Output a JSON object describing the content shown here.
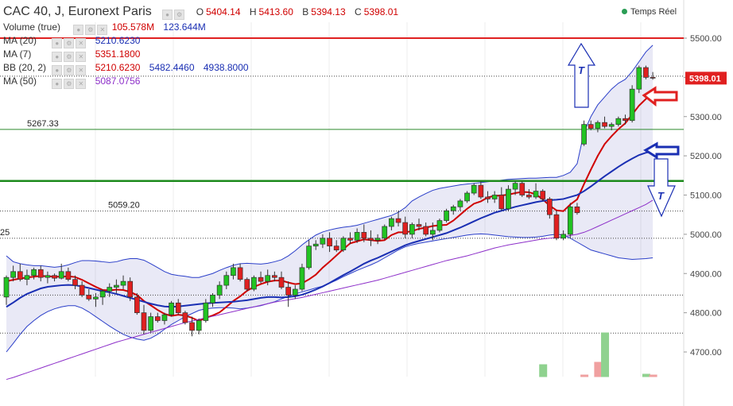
{
  "header": {
    "title": "CAC 40, J, Euronext Paris",
    "ohlc": [
      {
        "label": "O",
        "value": "5404.14"
      },
      {
        "label": "H",
        "value": "5413.60"
      },
      {
        "label": "B",
        "value": "5394.13"
      },
      {
        "label": "C",
        "value": "5398.01"
      }
    ],
    "realtime_label": "Temps Réel"
  },
  "indicators": [
    {
      "name": "Volume (true)",
      "values": [
        "105.578M",
        "123.644M"
      ],
      "colors": [
        "#d00000",
        "#1a2fb3"
      ]
    },
    {
      "name": "MA (20)",
      "values": [
        "5210.6230"
      ],
      "colors": [
        "#1a2fb3"
      ]
    },
    {
      "name": "MA (7)",
      "values": [
        "5351.1800"
      ],
      "colors": [
        "#d00000"
      ]
    },
    {
      "name": "BB (20, 2)",
      "values": [
        "5210.6230",
        "5482.4460",
        "4938.8000"
      ],
      "colors": [
        "#d00000",
        "#1a2fb3",
        "#1a2fb3"
      ]
    },
    {
      "name": "MA (50)",
      "values": [
        "5087.0756"
      ],
      "colors": [
        "#8d2fc9"
      ]
    }
  ],
  "price_label": "5398.01",
  "chart_data": {
    "type": "candlestick",
    "ylim": [
      4640,
      5550
    ],
    "y_ticks": [
      4700,
      4800,
      4900,
      5000,
      5100,
      5200,
      5300,
      5400,
      5500
    ],
    "y_tick_labels": [
      "4700.00",
      "4800.00",
      "4900.00",
      "5000.00",
      "5100.00",
      "5200.00",
      "5300.00",
      "5400.00",
      "5500.00"
    ],
    "candles": [
      [
        4840,
        4895,
        4820,
        4890
      ],
      [
        4890,
        4920,
        4880,
        4905
      ],
      [
        4905,
        4925,
        4880,
        4885
      ],
      [
        4885,
        4910,
        4870,
        4895
      ],
      [
        4895,
        4915,
        4885,
        4910
      ],
      [
        4910,
        4920,
        4880,
        4890
      ],
      [
        4890,
        4905,
        4875,
        4895
      ],
      [
        4895,
        4900,
        4880,
        4888
      ],
      [
        4888,
        4925,
        4885,
        4905
      ],
      [
        4905,
        4915,
        4880,
        4885
      ],
      [
        4885,
        4895,
        4860,
        4870
      ],
      [
        4870,
        4880,
        4840,
        4845
      ],
      [
        4845,
        4860,
        4830,
        4835
      ],
      [
        4835,
        4850,
        4815,
        4840
      ],
      [
        4840,
        4860,
        4820,
        4855
      ],
      [
        4855,
        4875,
        4840,
        4865
      ],
      [
        4865,
        4885,
        4850,
        4870
      ],
      [
        4870,
        4895,
        4860,
        4880
      ],
      [
        4880,
        4890,
        4830,
        4840
      ],
      [
        4840,
        4850,
        4795,
        4800
      ],
      [
        4800,
        4820,
        4745,
        4755
      ],
      [
        4755,
        4800,
        4750,
        4790
      ],
      [
        4790,
        4800,
        4775,
        4780
      ],
      [
        4780,
        4800,
        4770,
        4795
      ],
      [
        4795,
        4830,
        4790,
        4825
      ],
      [
        4825,
        4835,
        4795,
        4800
      ],
      [
        4800,
        4805,
        4770,
        4775
      ],
      [
        4775,
        4790,
        4740,
        4755
      ],
      [
        4755,
        4785,
        4745,
        4780
      ],
      [
        4780,
        4835,
        4775,
        4825
      ],
      [
        4825,
        4850,
        4815,
        4845
      ],
      [
        4845,
        4880,
        4835,
        4870
      ],
      [
        4870,
        4905,
        4860,
        4895
      ],
      [
        4895,
        4925,
        4885,
        4915
      ],
      [
        4915,
        4925,
        4880,
        4885
      ],
      [
        4885,
        4890,
        4855,
        4860
      ],
      [
        4860,
        4895,
        4855,
        4890
      ],
      [
        4890,
        4905,
        4875,
        4880
      ],
      [
        4880,
        4910,
        4870,
        4895
      ],
      [
        4895,
        4905,
        4880,
        4890
      ],
      [
        4890,
        4905,
        4860,
        4865
      ],
      [
        4865,
        4880,
        4815,
        4845
      ],
      [
        4845,
        4870,
        4835,
        4860
      ],
      [
        4860,
        4925,
        4855,
        4915
      ],
      [
        4915,
        4985,
        4910,
        4970
      ],
      [
        4970,
        4985,
        4960,
        4975
      ],
      [
        4975,
        5000,
        4965,
        4990
      ],
      [
        4990,
        5005,
        4955,
        4970
      ],
      [
        4970,
        4985,
        4955,
        4960
      ],
      [
        4960,
        4995,
        4955,
        4990
      ],
      [
        4990,
        5005,
        4975,
        4985
      ],
      [
        4985,
        5015,
        4978,
        5005
      ],
      [
        5005,
        5025,
        4980,
        4990
      ],
      [
        4990,
        5010,
        4970,
        4985
      ],
      [
        4985,
        5000,
        4975,
        4990
      ],
      [
        4990,
        5025,
        4985,
        5020
      ],
      [
        5020,
        5045,
        5010,
        5040
      ],
      [
        5040,
        5060,
        5020,
        5030
      ],
      [
        5030,
        5045,
        4990,
        5000
      ],
      [
        5000,
        5030,
        4990,
        5025
      ],
      [
        5025,
        5040,
        5010,
        5020
      ],
      [
        5020,
        5030,
        4995,
        5000
      ],
      [
        5000,
        5030,
        4985,
        5010
      ],
      [
        5010,
        5040,
        5005,
        5035
      ],
      [
        5035,
        5065,
        5030,
        5060
      ],
      [
        5060,
        5075,
        5050,
        5070
      ],
      [
        5070,
        5090,
        5060,
        5085
      ],
      [
        5085,
        5110,
        5080,
        5105
      ],
      [
        5105,
        5130,
        5100,
        5125
      ],
      [
        5125,
        5135,
        5090,
        5095
      ],
      [
        5095,
        5110,
        5080,
        5090
      ],
      [
        5090,
        5110,
        5080,
        5100
      ],
      [
        5100,
        5120,
        5060,
        5065
      ],
      [
        5065,
        5125,
        5060,
        5115
      ],
      [
        5115,
        5135,
        5100,
        5130
      ],
      [
        5130,
        5135,
        5095,
        5100
      ],
      [
        5100,
        5115,
        5090,
        5095
      ],
      [
        5095,
        5130,
        5090,
        5110
      ],
      [
        5110,
        5115,
        5085,
        5090
      ],
      [
        5090,
        5095,
        5040,
        5050
      ],
      [
        5050,
        5060,
        4985,
        4990
      ],
      [
        4990,
        5010,
        4985,
        5000
      ],
      [
        5000,
        5080,
        4990,
        5070
      ],
      [
        5070,
        5080,
        5050,
        5055
      ],
      [
        5230,
        5290,
        5225,
        5280
      ],
      [
        5280,
        5290,
        5265,
        5270
      ],
      [
        5270,
        5290,
        5260,
        5285
      ],
      [
        5285,
        5300,
        5270,
        5275
      ],
      [
        5275,
        5285,
        5265,
        5280
      ],
      [
        5280,
        5300,
        5275,
        5295
      ],
      [
        5295,
        5305,
        5280,
        5290
      ],
      [
        5290,
        5380,
        5285,
        5370
      ],
      [
        5370,
        5430,
        5360,
        5425
      ],
      [
        5425,
        5430,
        5395,
        5400
      ],
      [
        5400,
        5413.6,
        5394.1,
        5398.0
      ]
    ],
    "lines": [
      {
        "name": "MA (7)",
        "color": "#d00000",
        "values": [
          4880,
          4884,
          4887,
          4890,
          4892,
          4894,
          4893,
          4892,
          4892,
          4893,
          4891,
          4884,
          4875,
          4866,
          4858,
          4857,
          4859,
          4858,
          4853,
          4845,
          4830,
          4819,
          4807,
          4797,
          4792,
          4795,
          4793,
          4787,
          4779,
          4787,
          4793,
          4801,
          4815,
          4830,
          4842,
          4856,
          4866,
          4873,
          4879,
          4882,
          4882,
          4877,
          4873,
          4875,
          4885,
          4897,
          4915,
          4930,
          4946,
          4962,
          4977,
          4982,
          4987,
          4985,
          4983,
          4985,
          4998,
          5005,
          5005,
          5008,
          5014,
          5017,
          5021,
          5023,
          5024,
          5035,
          5050,
          5065,
          5078,
          5084,
          5094,
          5098,
          5099,
          5101,
          5105,
          5108,
          5107,
          5102,
          5089,
          5073,
          5061,
          5059,
          5076,
          5089,
          5128,
          5165,
          5200,
          5230,
          5250,
          5268,
          5283,
          5305,
          5328,
          5345,
          5360
        ]
      },
      {
        "name": "MA (20)",
        "color": "#1a2fb3",
        "values": [
          4815,
          4826,
          4838,
          4848,
          4855,
          4862,
          4866,
          4868,
          4870,
          4871,
          4870,
          4867,
          4863,
          4859,
          4855,
          4852,
          4848,
          4843,
          4838,
          4833,
          4828,
          4823,
          4819,
          4816,
          4815,
          4816,
          4818,
          4820,
          4822,
          4824,
          4825,
          4826,
          4827,
          4828,
          4830,
          4832,
          4835,
          4838,
          4840,
          4840,
          4839,
          4840,
          4842,
          4846,
          4852,
          4859,
          4867,
          4876,
          4886,
          4896,
          4905,
          4915,
          4925,
          4933,
          4940,
          4948,
          4956,
          4964,
          4972,
          4978,
          4983,
          4988,
          4993,
          4998,
          5003,
          5010,
          5017,
          5025,
          5033,
          5041,
          5048,
          5055,
          5060,
          5065,
          5070,
          5074,
          5078,
          5082,
          5085,
          5087,
          5088,
          5090,
          5095,
          5100,
          5110,
          5122,
          5135,
          5148,
          5160,
          5172,
          5183,
          5193,
          5202,
          5208,
          5211
        ]
      },
      {
        "name": "MA (50)",
        "color": "#8d2fc9",
        "values": [
          4630,
          4635,
          4641,
          4647,
          4653,
          4659,
          4665,
          4671,
          4677,
          4683,
          4689,
          4695,
          4701,
          4707,
          4713,
          4719,
          4725,
          4730,
          4735,
          4740,
          4745,
          4750,
          4755,
          4760,
          4765,
          4770,
          4775,
          4779,
          4783,
          4787,
          4791,
          4795,
          4799,
          4803,
          4807,
          4811,
          4815,
          4819,
          4823,
          4827,
          4830,
          4833,
          4836,
          4839,
          4843,
          4847,
          4851,
          4855,
          4859,
          4863,
          4867,
          4871,
          4875,
          4879,
          4883,
          4888,
          4893,
          4898,
          4903,
          4908,
          4913,
          4918,
          4923,
          4928,
          4933,
          4937,
          4941,
          4945,
          4950,
          4955,
          4960,
          4965,
          4969,
          4973,
          4976,
          4979,
          4982,
          4985,
          4988,
          4990,
          4992,
          4994,
          4997,
          5000,
          5005,
          5012,
          5020,
          5028,
          5036,
          5044,
          5052,
          5060,
          5068,
          5076,
          5087
        ]
      }
    ],
    "bb_upper": [
      4945,
      4930,
      4925,
      4922,
      4920,
      4920,
      4918,
      4916,
      4918,
      4922,
      4928,
      4933,
      4933,
      4932,
      4930,
      4928,
      4930,
      4935,
      4938,
      4938,
      4934,
      4925,
      4915,
      4905,
      4898,
      4895,
      4893,
      4890,
      4890,
      4895,
      4900,
      4908,
      4915,
      4921,
      4925,
      4926,
      4925,
      4924,
      4926,
      4930,
      4935,
      4945,
      4958,
      4973,
      4986,
      4998,
      5006,
      5011,
      5015,
      5018,
      5020,
      5023,
      5028,
      5033,
      5038,
      5043,
      5048,
      5056,
      5068,
      5085,
      5095,
      5104,
      5112,
      5117,
      5120,
      5123,
      5126,
      5128,
      5130,
      5132,
      5134,
      5136,
      5138,
      5140,
      5141,
      5142,
      5143,
      5143,
      5144,
      5145,
      5145,
      5150,
      5158,
      5180,
      5260,
      5300,
      5330,
      5350,
      5370,
      5385,
      5395,
      5415,
      5440,
      5465,
      5482
    ],
    "bb_lower": [
      4700,
      4722,
      4745,
      4765,
      4780,
      4793,
      4803,
      4810,
      4815,
      4818,
      4818,
      4812,
      4802,
      4790,
      4778,
      4766,
      4755,
      4745,
      4738,
      4733,
      4730,
      4735,
      4745,
      4758,
      4770,
      4780,
      4790,
      4798,
      4806,
      4810,
      4812,
      4813,
      4813,
      4812,
      4810,
      4812,
      4815,
      4818,
      4823,
      4828,
      4835,
      4842,
      4848,
      4853,
      4858,
      4863,
      4868,
      4875,
      4883,
      4892,
      4900,
      4908,
      4915,
      4922,
      4930,
      4940,
      4950,
      4960,
      4968,
      4973,
      4977,
      4980,
      4983,
      4986,
      4989,
      4992,
      4995,
      4998,
      5000,
      5001,
      5000,
      4998,
      4996,
      4994,
      4993,
      4992,
      4992,
      4993,
      4995,
      4998,
      5000,
      4998,
      4990,
      4980,
      4970,
      4960,
      4955,
      4950,
      4945,
      4940,
      4938,
      4936,
      4937,
      4938,
      4940
    ],
    "h_levels": [
      {
        "value": 5500,
        "color": "#e02020",
        "width": 2,
        "style": "solid",
        "label": ""
      },
      {
        "value": 5403,
        "color": "#444444",
        "width": 1,
        "style": "dotted",
        "label": ""
      },
      {
        "value": 5267.33,
        "color": "#2e8b2e",
        "width": 1,
        "style": "solid",
        "label": "5267.33"
      },
      {
        "value": 5136,
        "color": "#1c8a1c",
        "width": 2.5,
        "style": "solid",
        "label": ""
      },
      {
        "value": 5059.2,
        "color": "#444444",
        "width": 1,
        "style": "dotted",
        "label": "5059.20"
      },
      {
        "value": 4990,
        "color": "#444444",
        "width": 1,
        "style": "dotted",
        "label": "25"
      },
      {
        "value": 4845,
        "color": "#444444",
        "width": 1,
        "style": "dotted",
        "label": ""
      },
      {
        "value": 4748,
        "color": "#444444",
        "width": 1,
        "style": "dotted",
        "label": ""
      }
    ],
    "volume_bars": [
      {
        "index": 78,
        "volume": 15,
        "color": "#8fd28f"
      },
      {
        "index": 84,
        "volume": 2,
        "color": "#f0a0a0"
      },
      {
        "index": 86,
        "volume": 18,
        "color": "#f0a0a0"
      },
      {
        "index": 87,
        "volume": 55,
        "color": "#8fd28f"
      },
      {
        "index": 93,
        "volume": 3,
        "color": "#8fd28f"
      },
      {
        "index": 94,
        "volume": 2,
        "color": "#f0a0a0"
      }
    ],
    "annotations": [
      {
        "type": "arrow-up",
        "text": "T",
        "color": "#1a2fb3"
      },
      {
        "type": "arrow-left",
        "text": "",
        "color": "#e02020"
      },
      {
        "type": "arrow-left",
        "text": "",
        "color": "#1a2fb3"
      },
      {
        "type": "arrow-down",
        "text": "T",
        "color": "#1a2fb3"
      }
    ]
  }
}
